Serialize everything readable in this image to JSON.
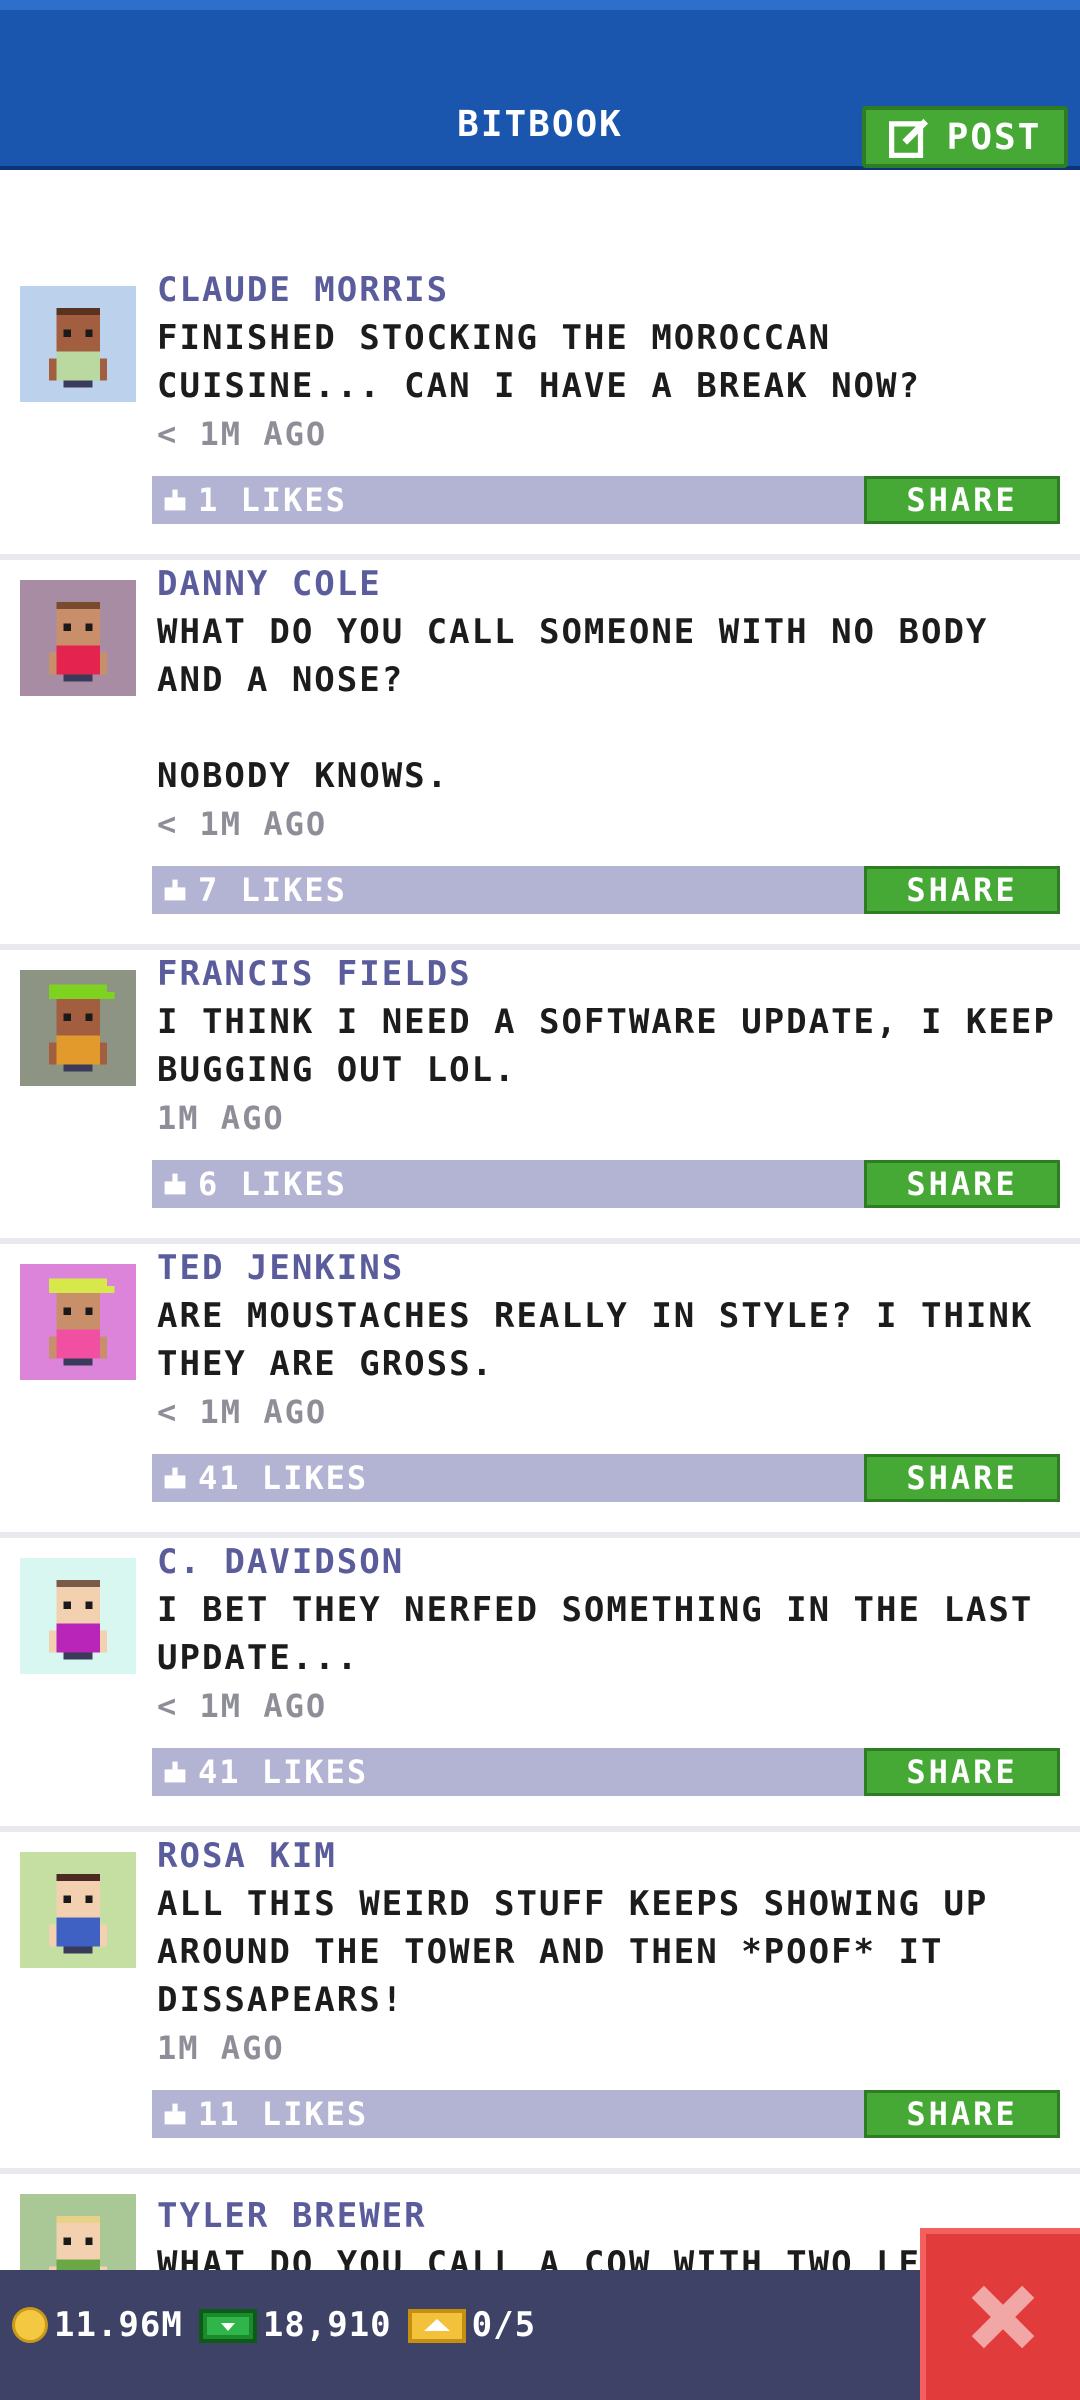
{
  "header": {
    "title": "BITBOOK",
    "post_label": "POST"
  },
  "posts": [
    {
      "author": "CLAUDE MORRIS",
      "message": "FINISHED STOCKING THE MOROCCAN CUISINE... CAN I HAVE A BREAK NOW?",
      "time": "< 1M AGO",
      "likes": "1 LIKES",
      "share": "SHARE",
      "avatar_bg": "#bcd2ec",
      "skin": "#a35e3f",
      "shirt": "#b9d9a0",
      "hair": "#5a3320",
      "hat": ""
    },
    {
      "author": "DANNY COLE",
      "message": "WHAT DO YOU CALL SOMEONE WITH NO BODY AND A NOSE?\n\nNOBODY KNOWS.",
      "time": "< 1M AGO",
      "likes": "7 LIKES",
      "share": "SHARE",
      "avatar_bg": "#a88ca3",
      "skin": "#c98f6b",
      "shirt": "#e5234f",
      "hair": "#7a4a2e",
      "hat": ""
    },
    {
      "author": "FRANCIS FIELDS",
      "message": "I THINK I NEED A SOFTWARE UPDATE, I KEEP BUGGING OUT LOL.",
      "time": "1M AGO",
      "likes": "6 LIKES",
      "share": "SHARE",
      "avatar_bg": "#8e9484",
      "skin": "#a35e3f",
      "shirt": "#e19a2b",
      "hair": "#1a1a1a",
      "hat": "#7ed321"
    },
    {
      "author": "TED JENKINS",
      "message": "ARE MOUSTACHES REALLY IN STYLE? I THINK THEY ARE GROSS.",
      "time": "< 1M AGO",
      "likes": "41 LIKES",
      "share": "SHARE",
      "avatar_bg": "#dc84d9",
      "skin": "#c98f6b",
      "shirt": "#f14fa1",
      "hair": "#5a3320",
      "hat": "#d7e84a"
    },
    {
      "author": "C. DAVIDSON",
      "message": "I BET THEY NERFED SOMETHING IN THE LAST UPDATE...",
      "time": "< 1M AGO",
      "likes": "41 LIKES",
      "share": "SHARE",
      "avatar_bg": "#d8f7f0",
      "skin": "#f3d1b0",
      "shirt": "#b924b9",
      "hair": "#7a5a48",
      "hat": ""
    },
    {
      "author": "ROSA KIM",
      "message": "ALL THIS WEIRD STUFF KEEPS SHOWING UP AROUND THE TOWER AND THEN *POOF* IT DISSAPEARS!",
      "time": "1M AGO",
      "likes": "11 LIKES",
      "share": "SHARE",
      "avatar_bg": "#c5dea2",
      "skin": "#f3d1b0",
      "shirt": "#3f61c4",
      "hair": "#4a2a22",
      "hat": ""
    },
    {
      "author": "TYLER BREWER",
      "message": "WHAT DO YOU CALL A COW WITH TWO LE",
      "time": "",
      "likes": "",
      "share": "",
      "avatar_bg": "#a9c896",
      "skin": "#f3d1b0",
      "shirt": "#6aa845",
      "hair": "#e8d28a",
      "hat": ""
    }
  ],
  "footer": {
    "coins": "11.96M",
    "bux": "18,910",
    "tickets": "0/5"
  },
  "colors": {
    "header": "#1a56ad",
    "accent_green": "#46a935",
    "like_bar": "#b3b3d4",
    "footer": "#3d4266",
    "close": "#e23b3b"
  }
}
